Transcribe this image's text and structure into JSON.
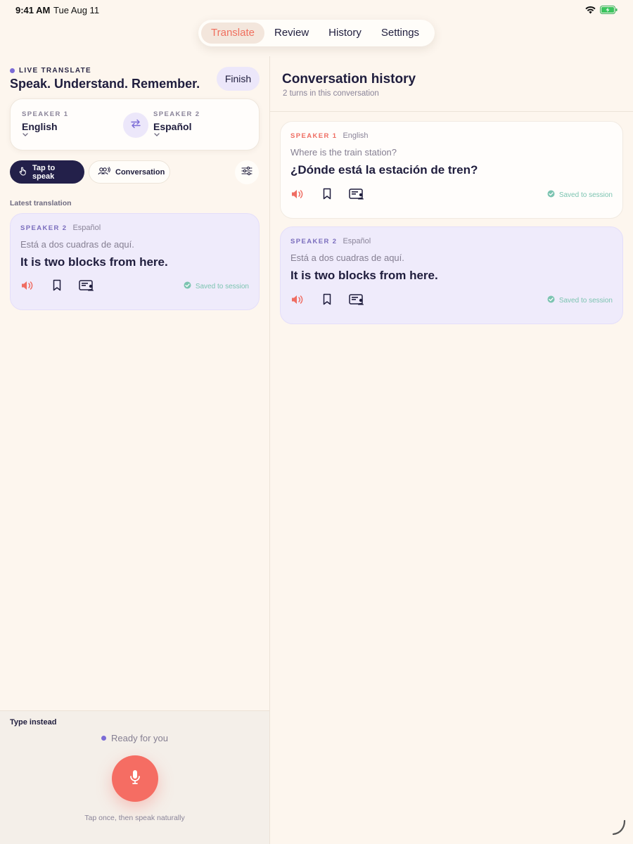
{
  "status_bar": {
    "time": "9:41 AM",
    "date": "Tue Aug 11"
  },
  "tabs": [
    {
      "label": "Translate",
      "active": true
    },
    {
      "label": "Review",
      "active": false
    },
    {
      "label": "History",
      "active": false
    },
    {
      "label": "Settings",
      "active": false
    }
  ],
  "left": {
    "live_label": "LIVE TRANSLATE",
    "headline": "Speak. Understand. Remember.",
    "finish_label": "Finish",
    "speaker1": {
      "tag": "SPEAKER 1",
      "language": "English"
    },
    "speaker2": {
      "tag": "SPEAKER 2",
      "language": "Español"
    },
    "tap_to_speak": "Tap to speak",
    "conversation": "Conversation",
    "latest_label": "Latest translation",
    "latest": {
      "speaker": "SPEAKER 2",
      "language": "Español",
      "source": "Está a dos cuadras de aquí.",
      "target": "It is two blocks from here.",
      "saved": "Saved to session"
    }
  },
  "dock": {
    "type_instead": "Type instead",
    "ready": "Ready for you",
    "hint": "Tap once, then speak naturally"
  },
  "history": {
    "title": "Conversation history",
    "subtitle": "2 turns in this conversation",
    "turns": [
      {
        "speaker": "SPEAKER 1",
        "language": "English",
        "source": "Where is the train station?",
        "target": "¿Dónde está la estación de tren?",
        "saved": "Saved to session"
      },
      {
        "speaker": "SPEAKER 2",
        "language": "Español",
        "source": "Está a dos cuadras de aquí.",
        "target": "It is two blocks from here.",
        "saved": "Saved to session"
      }
    ]
  },
  "colors": {
    "accent": "#f0705f",
    "brand_dark": "#23204a",
    "lavender": "#efebfb",
    "saved_green": "#7cc4b1"
  },
  "icons": [
    "wifi-icon",
    "battery-charging-icon",
    "swap-icon",
    "hand-tap-icon",
    "people-talk-icon",
    "sliders-icon",
    "speaker-icon",
    "bookmark-icon",
    "present-icon",
    "check-circle-icon",
    "microphone-icon"
  ]
}
